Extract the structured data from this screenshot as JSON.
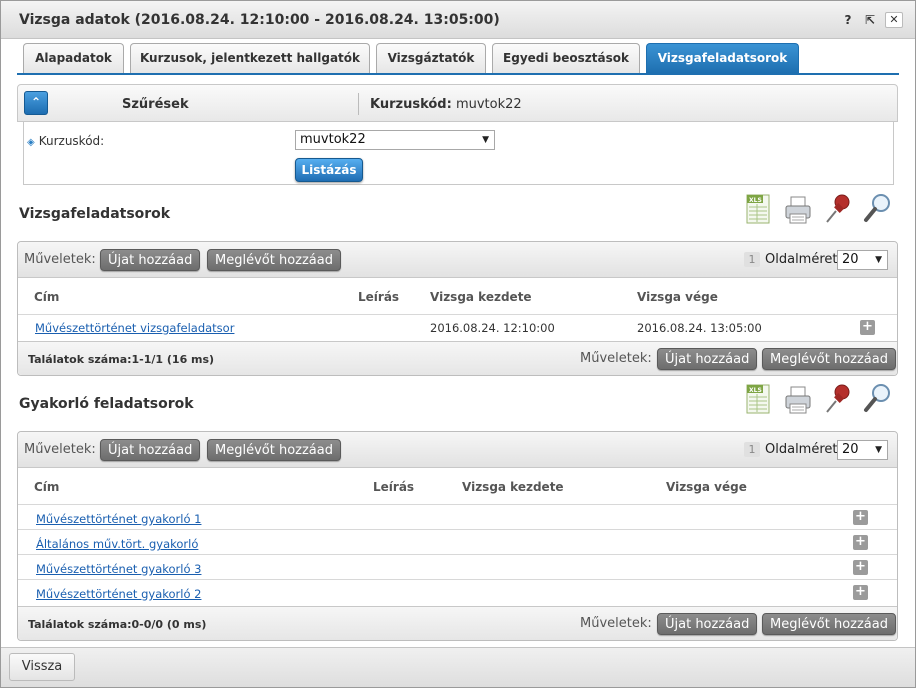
{
  "window": {
    "title": "Vizsga adatok (2016.08.24. 12:10:00 - 2016.08.24. 13:05:00)",
    "help_label": "?",
    "popout_label": "⇱",
    "close_label": "✕"
  },
  "tabs": [
    {
      "label": "Alapadatok",
      "active": false
    },
    {
      "label": "Kurzusok, jelentkezett hallgatók",
      "active": false
    },
    {
      "label": "Vizsgáztatók",
      "active": false
    },
    {
      "label": "Egyedi beosztások",
      "active": false
    },
    {
      "label": "Vizsgafeladatsorok",
      "active": true
    }
  ],
  "filter": {
    "collapse_icon": "⌃",
    "title": "Szűrések",
    "summary_label": "Kurzuskód:",
    "summary_value": "muvtok22",
    "field_label": "Kurzuskód:",
    "field_value": "muvtok22",
    "submit_label": "Listázás"
  },
  "toolbar_icons": [
    "excel-export-icon",
    "print-icon",
    "pin-icon",
    "magnifier-icon"
  ],
  "exam_sets": {
    "title": "Vizsgafeladatsorok",
    "ops_label": "Műveletek:",
    "add_new_label": "Újat hozzáad",
    "add_existing_label": "Meglévőt hozzáad",
    "page_number": "1",
    "page_size_label": "Oldalméret",
    "page_size_value": "20",
    "columns": {
      "title": "Cím",
      "description": "Leírás",
      "start": "Vizsga kezdete",
      "end": "Vizsga vége"
    },
    "rows": [
      {
        "title": "Művészettörténet vizsgafeladatsor",
        "description": "",
        "start": "2016.08.24. 12:10:00",
        "end": "2016.08.24. 13:05:00"
      }
    ],
    "result_count": "Találatok száma:1-1/1 (16 ms)"
  },
  "practice_sets": {
    "title": "Gyakorló feladatsorok",
    "ops_label": "Műveletek:",
    "add_new_label": "Újat hozzáad",
    "add_existing_label": "Meglévőt hozzáad",
    "page_number": "1",
    "page_size_label": "Oldalméret",
    "page_size_value": "20",
    "columns": {
      "title": "Cím",
      "description": "Leírás",
      "start": "Vizsga kezdete",
      "end": "Vizsga vége"
    },
    "rows": [
      {
        "title": "Művészettörténet gyakorló 1"
      },
      {
        "title": "Általános műv.tört. gyakorló"
      },
      {
        "title": "Művészettörténet gyakorló 3"
      },
      {
        "title": "Művészettörténet gyakorló 2"
      }
    ],
    "result_count": "Találatok száma:0-0/0 (0 ms)"
  },
  "footer": {
    "back_label": "Vissza"
  },
  "colors": {
    "accent": "#1e6fb0",
    "link": "#1a5fb0",
    "gray_button": "#7a7a7a"
  }
}
